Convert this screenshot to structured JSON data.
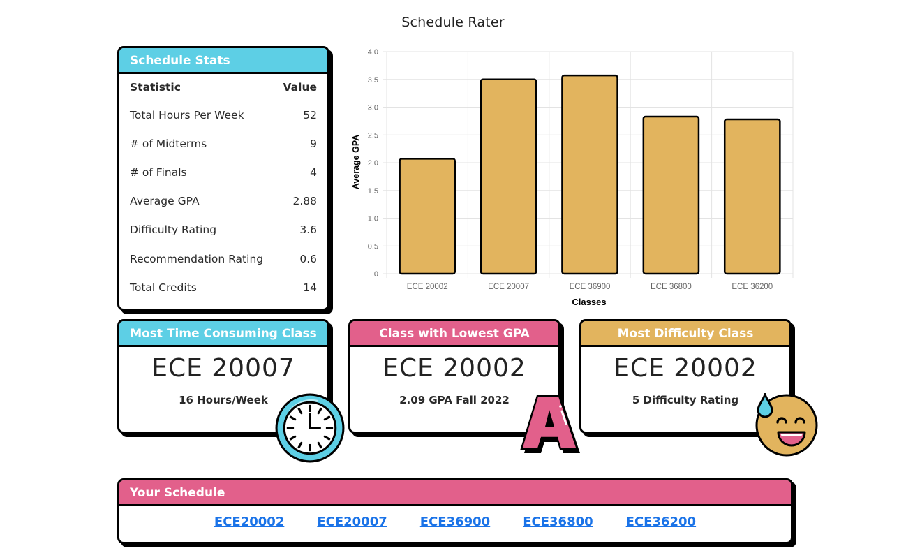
{
  "page": {
    "title": "Schedule Rater"
  },
  "stats": {
    "title": "Schedule Stats",
    "col_statistic": "Statistic",
    "col_value": "Value",
    "rows": [
      {
        "label": "Total Hours Per Week",
        "value": "52"
      },
      {
        "label": "# of Midterms",
        "value": "9"
      },
      {
        "label": "# of Finals",
        "value": "4"
      },
      {
        "label": "Average GPA",
        "value": "2.88"
      },
      {
        "label": "Difficulty Rating",
        "value": "3.6"
      },
      {
        "label": "Recommendation Rating",
        "value": "0.6"
      },
      {
        "label": "Total Credits",
        "value": "14"
      }
    ]
  },
  "highlights": {
    "time": {
      "title": "Most Time Consuming Class",
      "value": "ECE 20007",
      "sub": "16 Hours/Week",
      "icon": "clock-icon"
    },
    "gpa": {
      "title": "Class with Lowest GPA",
      "value": "ECE 20002",
      "sub": "2.09 GPA Fall 2022",
      "icon": "grade-a-icon"
    },
    "difficulty": {
      "title": "Most Difficulty Class",
      "value": "ECE 20002",
      "sub": "5 Difficulty Rating",
      "icon": "sweat-smile-icon"
    }
  },
  "schedule": {
    "title": "Your Schedule",
    "links": [
      "ECE20002",
      "ECE20007",
      "ECE36900",
      "ECE36800",
      "ECE36200"
    ]
  },
  "colors": {
    "blue": "#5dcfe5",
    "pink": "#e2608b",
    "gold": "#e2b45e",
    "link": "#1a73e8"
  },
  "chart_data": {
    "type": "bar",
    "title": "",
    "xlabel": "Classes",
    "ylabel": "Average GPA",
    "categories": [
      "ECE 20002",
      "ECE 20007",
      "ECE 36900",
      "ECE 36800",
      "ECE 36200"
    ],
    "values": [
      2.07,
      3.5,
      3.57,
      2.83,
      2.78
    ],
    "ylim": [
      0,
      4.0
    ],
    "yticks": [
      "0",
      "0.5",
      "1.0",
      "1.5",
      "2.0",
      "2.5",
      "3.0",
      "3.5",
      "4.0"
    ],
    "grid": true,
    "legend": "none",
    "bar_color": "#e2b45e"
  }
}
